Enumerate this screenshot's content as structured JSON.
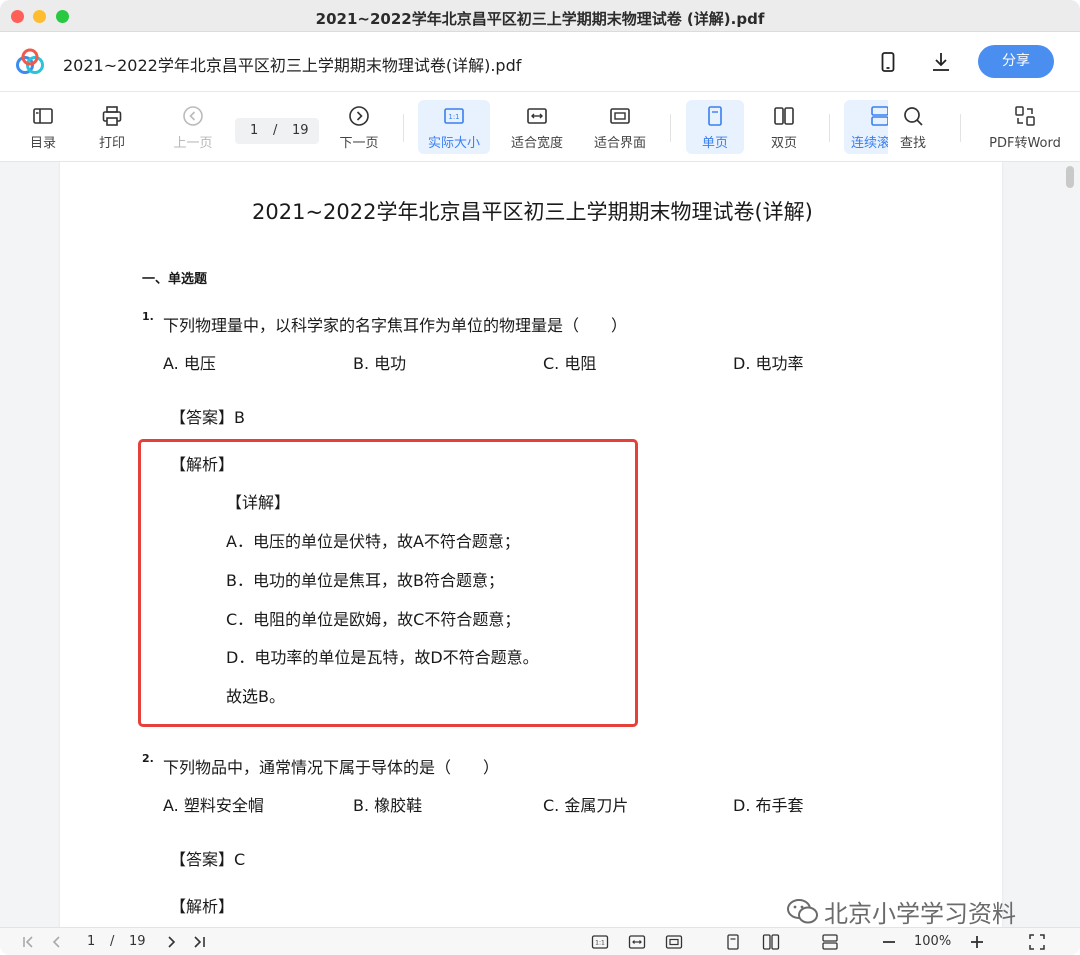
{
  "window": {
    "title": "2021~2022学年北京昌平区初三上学期期末物理试卷 (详解).pdf"
  },
  "header": {
    "doc_title": "2021~2022学年北京昌平区初三上学期期末物理试卷(详解).pdf",
    "share_label": "分享",
    "icons": [
      "baidu-netdisk-logo-icon",
      "phone-icon",
      "download-icon"
    ]
  },
  "toolbar": {
    "toc": "目录",
    "print": "打印",
    "prev_page": "上一页",
    "current_page": "1",
    "page_sep": "/",
    "total_pages": "19",
    "next_page": "下一页",
    "actual_size": "实际大小",
    "fit_width": "适合宽度",
    "fit_page": "适合界面",
    "single_page": "单页",
    "double_page": "双页",
    "continuous": "连续滚",
    "find": "查找",
    "pdf_to_word": "PDF转Word"
  },
  "document": {
    "title": "2021~2022学年北京昌平区初三上学期期末物理试卷(详解)",
    "section": "一、单选题",
    "questions": [
      {
        "num": "1.",
        "text": "下列物理量中，以科学家的名字焦耳作为单位的物理量是（　　）",
        "options": [
          "A. 电压",
          "B. 电功",
          "C. 电阻",
          "D. 电功率"
        ],
        "answer": "【答案】B",
        "analysis_label": "【解析】",
        "detail_label": "【详解】",
        "details": [
          "A．电压的单位是伏特，故A不符合题意；",
          "B．电功的单位是焦耳，故B符合题意；",
          "C．电阻的单位是欧姆，故C不符合题意；",
          "D．电功率的单位是瓦特，故D不符合题意。"
        ],
        "conclusion": "故选B。"
      },
      {
        "num": "2.",
        "text": "下列物品中，通常情况下属于导体的是（　　）",
        "options": [
          "A. 塑料安全帽",
          "B. 橡胶鞋",
          "C. 金属刀片",
          "D. 布手套"
        ],
        "answer": "【答案】C",
        "analysis_label": "【解析】"
      }
    ]
  },
  "watermark": "北京小学学习资料",
  "bottombar": {
    "current_page": "1",
    "page_sep": "/",
    "total_pages": "19",
    "zoom": "100%"
  },
  "colors": {
    "accent": "#4a8ef0",
    "highlight_border": "#e5413a",
    "active_bg": "#e8f1fe"
  }
}
